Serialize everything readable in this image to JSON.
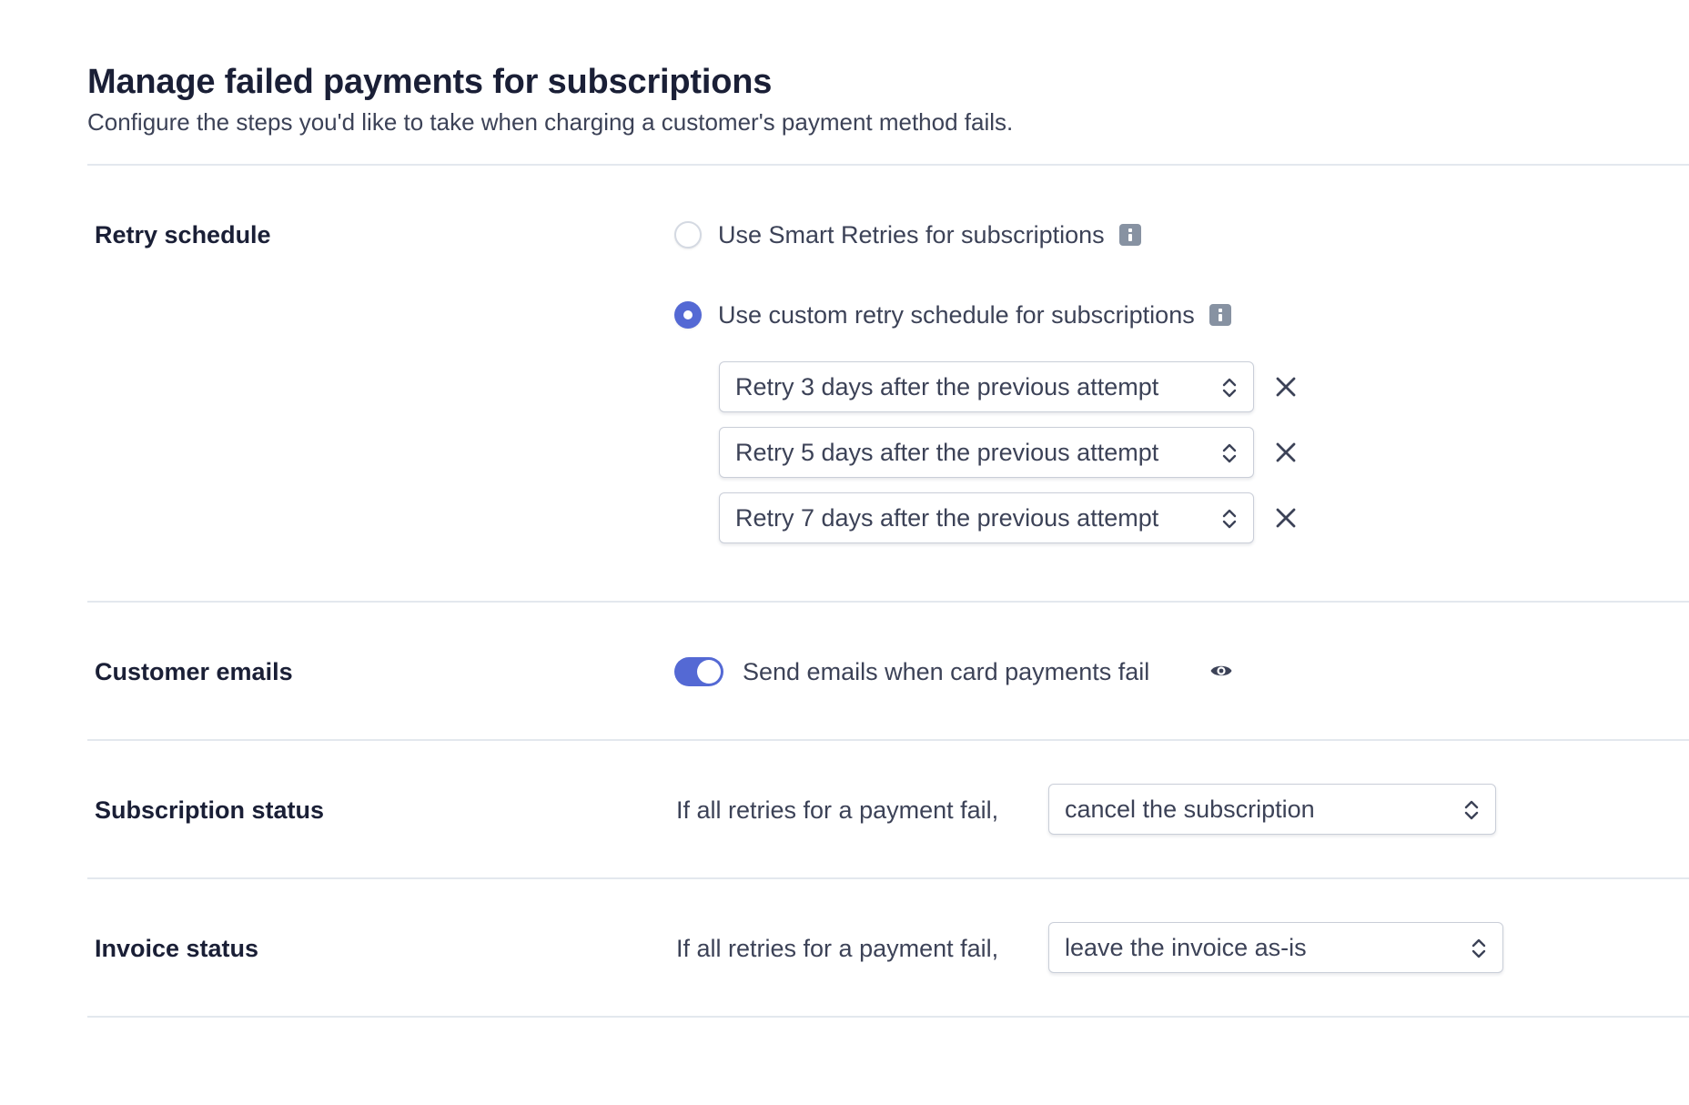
{
  "header": {
    "title": "Manage failed payments for subscriptions",
    "subtitle": "Configure the steps you'd like to take when charging a customer's payment method fails."
  },
  "retry_schedule": {
    "label": "Retry schedule",
    "options": [
      {
        "label": "Use Smart Retries for subscriptions",
        "selected": false,
        "icon": "info-icon"
      },
      {
        "label": "Use custom retry schedule for subscriptions",
        "selected": true,
        "icon": "info-icon"
      }
    ],
    "steps": [
      {
        "value": "Retry 3 days after the previous attempt"
      },
      {
        "value": "Retry 5 days after the previous attempt"
      },
      {
        "value": "Retry 7 days after the previous attempt"
      }
    ]
  },
  "customer_emails": {
    "label": "Customer emails",
    "toggle_on": true,
    "toggle_label": "Send emails when card payments fail",
    "icon": "eye-icon"
  },
  "subscription_status": {
    "label": "Subscription status",
    "prefix": "If all retries for a payment fail,",
    "value": "cancel the subscription"
  },
  "invoice_status": {
    "label": "Invoice status",
    "prefix": "If all retries for a payment fail,",
    "value": "leave the invoice as-is"
  },
  "colors": {
    "accent": "#5469d4",
    "text": "#1a1f36",
    "muted_text": "#3c4257",
    "divider": "#e3e8ee",
    "icon": "#8792a2"
  }
}
